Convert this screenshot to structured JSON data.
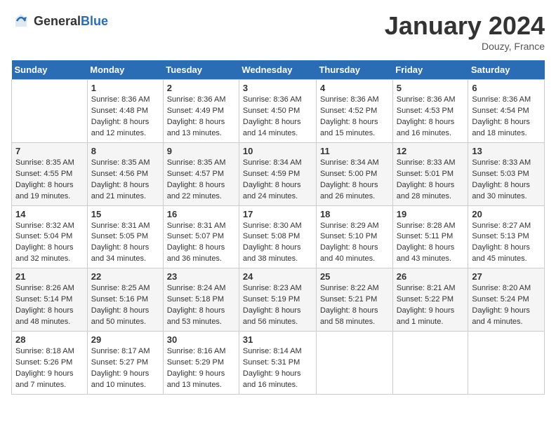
{
  "header": {
    "logo_general": "General",
    "logo_blue": "Blue",
    "title": "January 2024",
    "location": "Douzy, France"
  },
  "weekdays": [
    "Sunday",
    "Monday",
    "Tuesday",
    "Wednesday",
    "Thursday",
    "Friday",
    "Saturday"
  ],
  "weeks": [
    [
      {
        "day": "",
        "sunrise": "",
        "sunset": "",
        "daylight": ""
      },
      {
        "day": "1",
        "sunrise": "Sunrise: 8:36 AM",
        "sunset": "Sunset: 4:48 PM",
        "daylight": "Daylight: 8 hours and 12 minutes."
      },
      {
        "day": "2",
        "sunrise": "Sunrise: 8:36 AM",
        "sunset": "Sunset: 4:49 PM",
        "daylight": "Daylight: 8 hours and 13 minutes."
      },
      {
        "day": "3",
        "sunrise": "Sunrise: 8:36 AM",
        "sunset": "Sunset: 4:50 PM",
        "daylight": "Daylight: 8 hours and 14 minutes."
      },
      {
        "day": "4",
        "sunrise": "Sunrise: 8:36 AM",
        "sunset": "Sunset: 4:52 PM",
        "daylight": "Daylight: 8 hours and 15 minutes."
      },
      {
        "day": "5",
        "sunrise": "Sunrise: 8:36 AM",
        "sunset": "Sunset: 4:53 PM",
        "daylight": "Daylight: 8 hours and 16 minutes."
      },
      {
        "day": "6",
        "sunrise": "Sunrise: 8:36 AM",
        "sunset": "Sunset: 4:54 PM",
        "daylight": "Daylight: 8 hours and 18 minutes."
      }
    ],
    [
      {
        "day": "7",
        "sunrise": "Sunrise: 8:35 AM",
        "sunset": "Sunset: 4:55 PM",
        "daylight": "Daylight: 8 hours and 19 minutes."
      },
      {
        "day": "8",
        "sunrise": "Sunrise: 8:35 AM",
        "sunset": "Sunset: 4:56 PM",
        "daylight": "Daylight: 8 hours and 21 minutes."
      },
      {
        "day": "9",
        "sunrise": "Sunrise: 8:35 AM",
        "sunset": "Sunset: 4:57 PM",
        "daylight": "Daylight: 8 hours and 22 minutes."
      },
      {
        "day": "10",
        "sunrise": "Sunrise: 8:34 AM",
        "sunset": "Sunset: 4:59 PM",
        "daylight": "Daylight: 8 hours and 24 minutes."
      },
      {
        "day": "11",
        "sunrise": "Sunrise: 8:34 AM",
        "sunset": "Sunset: 5:00 PM",
        "daylight": "Daylight: 8 hours and 26 minutes."
      },
      {
        "day": "12",
        "sunrise": "Sunrise: 8:33 AM",
        "sunset": "Sunset: 5:01 PM",
        "daylight": "Daylight: 8 hours and 28 minutes."
      },
      {
        "day": "13",
        "sunrise": "Sunrise: 8:33 AM",
        "sunset": "Sunset: 5:03 PM",
        "daylight": "Daylight: 8 hours and 30 minutes."
      }
    ],
    [
      {
        "day": "14",
        "sunrise": "Sunrise: 8:32 AM",
        "sunset": "Sunset: 5:04 PM",
        "daylight": "Daylight: 8 hours and 32 minutes."
      },
      {
        "day": "15",
        "sunrise": "Sunrise: 8:31 AM",
        "sunset": "Sunset: 5:05 PM",
        "daylight": "Daylight: 8 hours and 34 minutes."
      },
      {
        "day": "16",
        "sunrise": "Sunrise: 8:31 AM",
        "sunset": "Sunset: 5:07 PM",
        "daylight": "Daylight: 8 hours and 36 minutes."
      },
      {
        "day": "17",
        "sunrise": "Sunrise: 8:30 AM",
        "sunset": "Sunset: 5:08 PM",
        "daylight": "Daylight: 8 hours and 38 minutes."
      },
      {
        "day": "18",
        "sunrise": "Sunrise: 8:29 AM",
        "sunset": "Sunset: 5:10 PM",
        "daylight": "Daylight: 8 hours and 40 minutes."
      },
      {
        "day": "19",
        "sunrise": "Sunrise: 8:28 AM",
        "sunset": "Sunset: 5:11 PM",
        "daylight": "Daylight: 8 hours and 43 minutes."
      },
      {
        "day": "20",
        "sunrise": "Sunrise: 8:27 AM",
        "sunset": "Sunset: 5:13 PM",
        "daylight": "Daylight: 8 hours and 45 minutes."
      }
    ],
    [
      {
        "day": "21",
        "sunrise": "Sunrise: 8:26 AM",
        "sunset": "Sunset: 5:14 PM",
        "daylight": "Daylight: 8 hours and 48 minutes."
      },
      {
        "day": "22",
        "sunrise": "Sunrise: 8:25 AM",
        "sunset": "Sunset: 5:16 PM",
        "daylight": "Daylight: 8 hours and 50 minutes."
      },
      {
        "day": "23",
        "sunrise": "Sunrise: 8:24 AM",
        "sunset": "Sunset: 5:18 PM",
        "daylight": "Daylight: 8 hours and 53 minutes."
      },
      {
        "day": "24",
        "sunrise": "Sunrise: 8:23 AM",
        "sunset": "Sunset: 5:19 PM",
        "daylight": "Daylight: 8 hours and 56 minutes."
      },
      {
        "day": "25",
        "sunrise": "Sunrise: 8:22 AM",
        "sunset": "Sunset: 5:21 PM",
        "daylight": "Daylight: 8 hours and 58 minutes."
      },
      {
        "day": "26",
        "sunrise": "Sunrise: 8:21 AM",
        "sunset": "Sunset: 5:22 PM",
        "daylight": "Daylight: 9 hours and 1 minute."
      },
      {
        "day": "27",
        "sunrise": "Sunrise: 8:20 AM",
        "sunset": "Sunset: 5:24 PM",
        "daylight": "Daylight: 9 hours and 4 minutes."
      }
    ],
    [
      {
        "day": "28",
        "sunrise": "Sunrise: 8:18 AM",
        "sunset": "Sunset: 5:26 PM",
        "daylight": "Daylight: 9 hours and 7 minutes."
      },
      {
        "day": "29",
        "sunrise": "Sunrise: 8:17 AM",
        "sunset": "Sunset: 5:27 PM",
        "daylight": "Daylight: 9 hours and 10 minutes."
      },
      {
        "day": "30",
        "sunrise": "Sunrise: 8:16 AM",
        "sunset": "Sunset: 5:29 PM",
        "daylight": "Daylight: 9 hours and 13 minutes."
      },
      {
        "day": "31",
        "sunrise": "Sunrise: 8:14 AM",
        "sunset": "Sunset: 5:31 PM",
        "daylight": "Daylight: 9 hours and 16 minutes."
      },
      {
        "day": "",
        "sunrise": "",
        "sunset": "",
        "daylight": ""
      },
      {
        "day": "",
        "sunrise": "",
        "sunset": "",
        "daylight": ""
      },
      {
        "day": "",
        "sunrise": "",
        "sunset": "",
        "daylight": ""
      }
    ]
  ]
}
